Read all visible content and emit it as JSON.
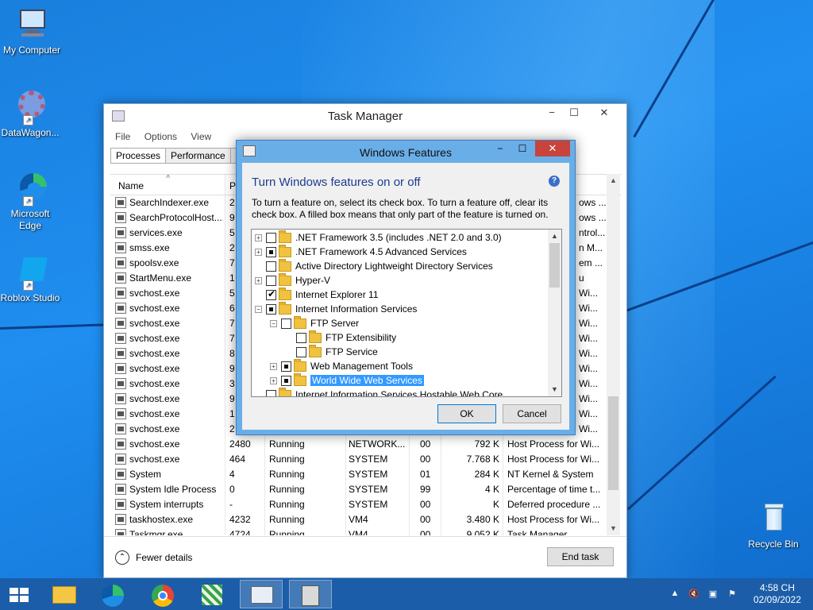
{
  "desktop": {
    "icons": [
      {
        "label": "My Computer"
      },
      {
        "label": "DataWagon..."
      },
      {
        "label": "Microsoft Edge"
      },
      {
        "label": "Roblox Studio"
      },
      {
        "label": "Recycle Bin"
      }
    ]
  },
  "task_manager": {
    "title": "Task Manager",
    "menu": [
      "File",
      "Options",
      "View"
    ],
    "tabs": [
      "Processes",
      "Performance",
      "A"
    ],
    "columns": {
      "name": "Name",
      "pid": "P"
    },
    "partial_rows": [
      {
        "name": "SearchIndexer.exe",
        "pid": "2",
        "desc": "ows ..."
      },
      {
        "name": "SearchProtocolHost....",
        "pid": "9",
        "desc": "ows ..."
      },
      {
        "name": "services.exe",
        "pid": "5",
        "desc": "ntrol..."
      },
      {
        "name": "smss.exe",
        "pid": "2",
        "desc": "n M..."
      },
      {
        "name": "spoolsv.exe",
        "pid": "7",
        "desc": "em ..."
      },
      {
        "name": "StartMenu.exe",
        "pid": "1",
        "desc": "u"
      },
      {
        "name": "svchost.exe",
        "pid": "5",
        "desc": "Wi..."
      },
      {
        "name": "svchost.exe",
        "pid": "6",
        "desc": "Wi..."
      },
      {
        "name": "svchost.exe",
        "pid": "7",
        "desc": "Wi..."
      },
      {
        "name": "svchost.exe",
        "pid": "7",
        "desc": "Wi..."
      },
      {
        "name": "svchost.exe",
        "pid": "8",
        "desc": "Wi..."
      },
      {
        "name": "svchost.exe",
        "pid": "9",
        "desc": "Wi..."
      },
      {
        "name": "svchost.exe",
        "pid": "3",
        "desc": "Wi..."
      },
      {
        "name": "svchost.exe",
        "pid": "9",
        "desc": "Wi..."
      },
      {
        "name": "svchost.exe",
        "pid": "1",
        "desc": "Wi..."
      },
      {
        "name": "svchost.exe",
        "pid": "2",
        "desc": "Wi..."
      }
    ],
    "full_rows": [
      {
        "name": "svchost.exe",
        "pid": "2480",
        "status": "Running",
        "user": "NETWORK...",
        "cpu": "00",
        "mem": "792 K",
        "desc": "Host Process for Wi..."
      },
      {
        "name": "svchost.exe",
        "pid": "464",
        "status": "Running",
        "user": "SYSTEM",
        "cpu": "00",
        "mem": "7.768 K",
        "desc": "Host Process for Wi..."
      },
      {
        "name": "System",
        "pid": "4",
        "status": "Running",
        "user": "SYSTEM",
        "cpu": "01",
        "mem": "284 K",
        "desc": "NT Kernel & System"
      },
      {
        "name": "System Idle Process",
        "pid": "0",
        "status": "Running",
        "user": "SYSTEM",
        "cpu": "99",
        "mem": "4 K",
        "desc": "Percentage of time t..."
      },
      {
        "name": "System interrupts",
        "pid": "-",
        "status": "Running",
        "user": "SYSTEM",
        "cpu": "00",
        "mem": "K",
        "desc": "Deferred procedure ..."
      },
      {
        "name": "taskhostex.exe",
        "pid": "4232",
        "status": "Running",
        "user": "VM4",
        "cpu": "00",
        "mem": "3.480 K",
        "desc": "Host Process for Wi..."
      },
      {
        "name": "Taskmgr.exe",
        "pid": "4724",
        "status": "Running",
        "user": "VM4",
        "cpu": "00",
        "mem": "9.052 K",
        "desc": "Task Manager"
      }
    ],
    "fewer_details": "Fewer details",
    "end_task": "End task"
  },
  "windows_features": {
    "title": "Windows Features",
    "heading": "Turn Windows features on or off",
    "description": "To turn a feature on, select its check box. To turn a feature off, clear its check box. A filled box means that only part of the feature is turned on.",
    "features": [
      {
        "label": ".NET Framework 3.5 (includes .NET 2.0 and 3.0)",
        "depth": 0,
        "expander": "+",
        "state": "unchecked"
      },
      {
        "label": ".NET Framework 4.5 Advanced Services",
        "depth": 0,
        "expander": "+",
        "state": "partial"
      },
      {
        "label": "Active Directory Lightweight Directory Services",
        "depth": 0,
        "expander": "",
        "state": "unchecked"
      },
      {
        "label": "Hyper-V",
        "depth": 0,
        "expander": "+",
        "state": "unchecked"
      },
      {
        "label": "Internet Explorer 11",
        "depth": 0,
        "expander": "",
        "state": "checked"
      },
      {
        "label": "Internet Information Services",
        "depth": 0,
        "expander": "−",
        "state": "partial"
      },
      {
        "label": "FTP Server",
        "depth": 1,
        "expander": "−",
        "state": "unchecked"
      },
      {
        "label": "FTP Extensibility",
        "depth": 2,
        "expander": "",
        "state": "unchecked"
      },
      {
        "label": "FTP Service",
        "depth": 2,
        "expander": "",
        "state": "unchecked"
      },
      {
        "label": "Web Management Tools",
        "depth": 1,
        "expander": "+",
        "state": "partial"
      },
      {
        "label": "World Wide Web Services",
        "depth": 1,
        "expander": "+",
        "state": "partial",
        "selected": true
      },
      {
        "label": "Internet Information Services Hostable Web Core",
        "depth": 0,
        "expander": "",
        "state": "unchecked"
      }
    ],
    "ok": "OK",
    "cancel": "Cancel"
  },
  "taskbar": {
    "time": "4:58 CH",
    "date": "02/09/2022"
  }
}
